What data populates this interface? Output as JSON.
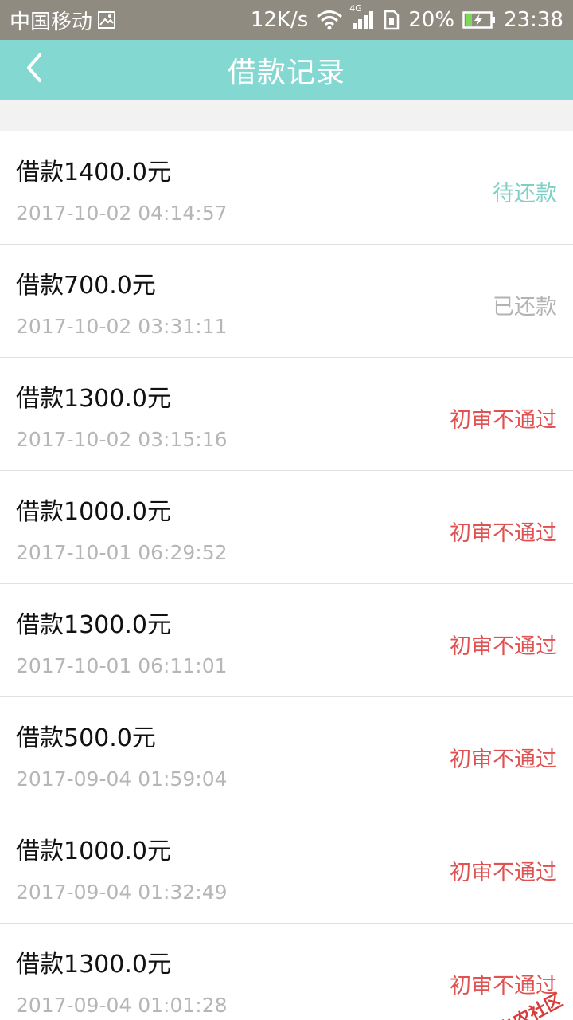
{
  "status_bar": {
    "carrier": "中国移动",
    "net_speed": "12K/s",
    "battery_percent": "20%",
    "time": "23:38",
    "network_type": "4G",
    "icons": [
      "image-notification-icon",
      "wifi-icon",
      "signal-icon",
      "sim-icon",
      "battery-charging-icon"
    ]
  },
  "header": {
    "title": "借款记录",
    "back_icon": "chevron-left-icon",
    "background": "#83d8d1"
  },
  "colors": {
    "pending": "#7ed0c6",
    "repaid": "#b3b3b3",
    "rejected": "#e05252"
  },
  "records": [
    {
      "amount": "借款1400.0元",
      "time": "2017-10-02 04:14:57",
      "status": "待还款",
      "status_type": "pending"
    },
    {
      "amount": "借款700.0元",
      "time": "2017-10-02 03:31:11",
      "status": "已还款",
      "status_type": "repaid"
    },
    {
      "amount": "借款1300.0元",
      "time": "2017-10-02 03:15:16",
      "status": "初审不通过",
      "status_type": "rejected"
    },
    {
      "amount": "借款1000.0元",
      "time": "2017-10-01 06:29:52",
      "status": "初审不通过",
      "status_type": "rejected"
    },
    {
      "amount": "借款1300.0元",
      "time": "2017-10-01 06:11:01",
      "status": "初审不通过",
      "status_type": "rejected"
    },
    {
      "amount": "借款500.0元",
      "time": "2017-09-04 01:59:04",
      "status": "初审不通过",
      "status_type": "rejected"
    },
    {
      "amount": "借款1000.0元",
      "time": "2017-09-04 01:32:49",
      "status": "初审不通过",
      "status_type": "rejected"
    },
    {
      "amount": "借款1300.0元",
      "time": "2017-09-04 01:01:28",
      "status": "初审不通过",
      "status_type": "rejected"
    }
  ],
  "watermark": {
    "text": "卡农社区",
    "icon": "kanong-logo-icon"
  }
}
